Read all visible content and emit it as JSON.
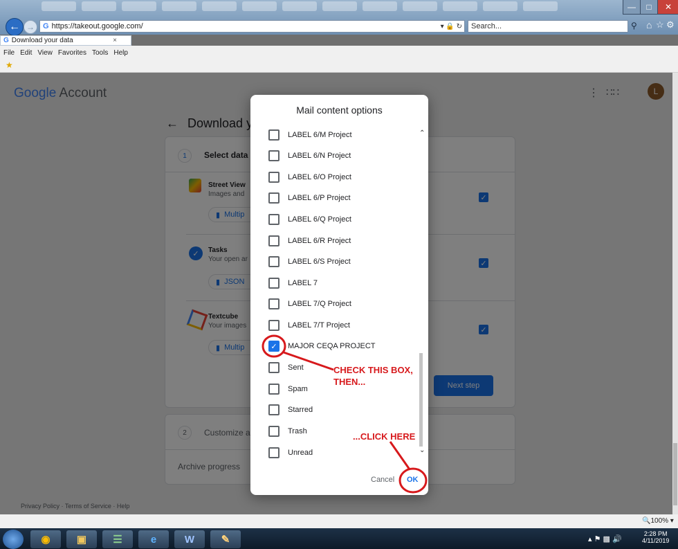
{
  "browser": {
    "url": "https://takeout.google.com/",
    "search_placeholder": "Search...",
    "tab_title": "Download your data",
    "menu": [
      "File",
      "Edit",
      "View",
      "Favorites",
      "Tools",
      "Help"
    ],
    "zoom": "100%"
  },
  "page": {
    "brand_google": "Google",
    "brand_account": "Account",
    "avatar_letter": "L",
    "heading": "Download yo",
    "step1_num": "1",
    "step1_label": "Select data",
    "products": [
      {
        "name": "Street View",
        "desc": "Images and",
        "format": "Multip"
      },
      {
        "name": "Tasks",
        "desc": "Your open ar",
        "format": "JSON"
      },
      {
        "name": "Textcube",
        "desc": "Your images",
        "format": "Multip"
      }
    ],
    "next_step": "Next step",
    "step2_num": "2",
    "step2_label": "Customize a",
    "archive_progress": "Archive progress",
    "footer": [
      "Privacy Policy",
      "Terms of Service",
      "Help"
    ]
  },
  "dialog": {
    "title": "Mail content options",
    "options": [
      {
        "label": "LABEL 6/M Project",
        "checked": false
      },
      {
        "label": "LABEL 6/N Project",
        "checked": false
      },
      {
        "label": "LABEL 6/O Project",
        "checked": false
      },
      {
        "label": "LABEL 6/P Project",
        "checked": false
      },
      {
        "label": "LABEL 6/Q Project",
        "checked": false
      },
      {
        "label": "LABEL 6/R Project",
        "checked": false
      },
      {
        "label": "LABEL 6/S Project",
        "checked": false
      },
      {
        "label": "LABEL 7",
        "checked": false
      },
      {
        "label": "LABEL 7/Q Project",
        "checked": false
      },
      {
        "label": "LABEL 7/T Project",
        "checked": false
      },
      {
        "label": "MAJOR CEQA PROJECT",
        "checked": true
      },
      {
        "label": "Sent",
        "checked": false
      },
      {
        "label": "Spam",
        "checked": false
      },
      {
        "label": "Starred",
        "checked": false
      },
      {
        "label": "Trash",
        "checked": false
      },
      {
        "label": "Unread",
        "checked": false
      }
    ],
    "cancel": "Cancel",
    "ok": "OK"
  },
  "annotations": {
    "check_line1": "CHECK THIS BOX,",
    "check_line2": "THEN...",
    "click_here": "...CLICK HERE"
  },
  "taskbar": {
    "time": "2:28 PM",
    "date": "4/11/2019"
  },
  "colors": {
    "accent": "#1a73e8",
    "annotation": "#d7191c"
  }
}
